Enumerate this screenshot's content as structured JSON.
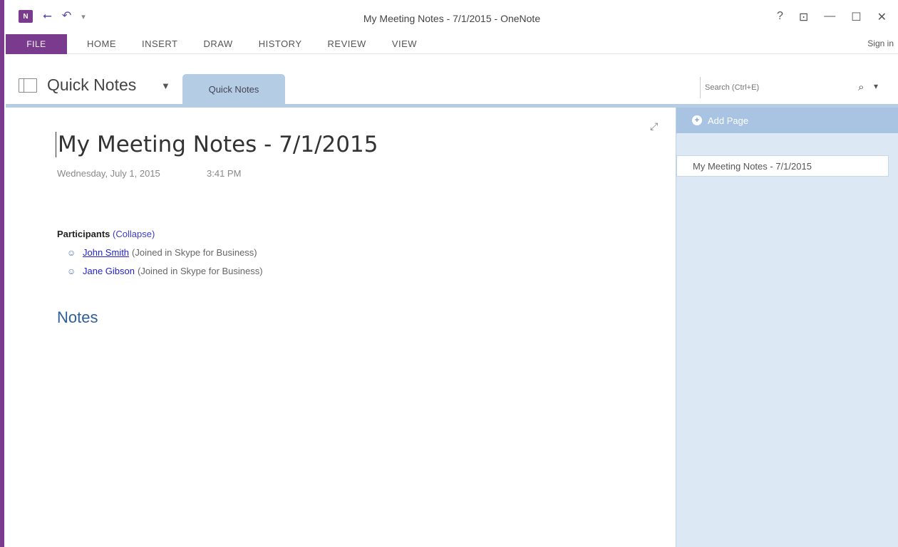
{
  "titlebar": {
    "app_logo": "N",
    "window_title": "My Meeting Notes - 7/1/2015 - OneNote",
    "controls": [
      "?",
      "⊡",
      "—",
      "☐",
      "✕"
    ]
  },
  "ribbon": {
    "file_tab": "FILE",
    "tabs": [
      "HOME",
      "INSERT",
      "DRAW",
      "HISTORY",
      "REVIEW",
      "VIEW"
    ],
    "signin": "Sign in"
  },
  "notebook": {
    "name": "Quick Notes",
    "section_tab": "Quick Notes",
    "search_placeholder": "Search (Ctrl+E)"
  },
  "page": {
    "title": "My Meeting Notes - 7/1/2015",
    "date": "Wednesday, July 1, 2015",
    "time": "3:41 PM",
    "participants_label": "Participants",
    "collapse_label": "(Collapse)",
    "participants": [
      {
        "name": "John Smith",
        "note": "(Joined in Skype for Business)"
      },
      {
        "name": "Jane Gibson",
        "note": "(Joined in Skype for Business)"
      }
    ],
    "notes_heading": "Notes"
  },
  "pane": {
    "add_page": "Add Page",
    "pages": [
      "My Meeting Notes - 7/1/2015"
    ]
  },
  "colors": {
    "accent": "#7a3b8f",
    "section_tab": "#b5cde4",
    "pane_bg": "#dce8f4",
    "heading_blue": "#2e5f9a"
  }
}
